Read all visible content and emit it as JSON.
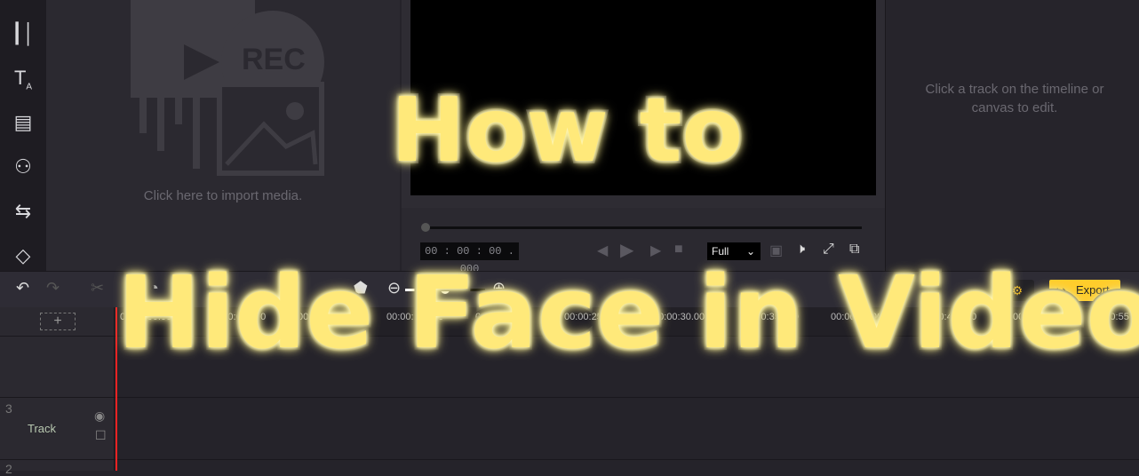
{
  "sidebar": {
    "icons": [
      "audio-wave-icon",
      "text-icon",
      "overlay-icon",
      "filter-icon",
      "transition-icon",
      "element-icon"
    ]
  },
  "media": {
    "import_text": "Click here to import media.",
    "rec_label": "REC"
  },
  "preview": {
    "timecode": "00 : 00 : 00 . 000",
    "zoom": "Full"
  },
  "properties": {
    "hint": "Click a track on the timeline or canvas to edit."
  },
  "toolbar": {
    "export_label": "Export"
  },
  "ruler": {
    "ticks": [
      "00:00:00.000",
      "00:00:05.000",
      "00:00:10.000",
      "00:00:15.000",
      "00:00:20.000",
      "00:00:25.000",
      "00:00:30.000",
      "00:00:35.000",
      "00:00:40.000",
      "00:00:45.000",
      "00:00:50.000",
      "00:00:55"
    ]
  },
  "tracks": [
    {
      "number": "3",
      "label": "Track"
    },
    {
      "number": "2"
    }
  ],
  "overlay": {
    "line1": "How to",
    "line2": "Hide Face in Video"
  },
  "colors": {
    "accent": "#ffcd2b",
    "overlay_text": "#ffe97a",
    "playhead": "#ee2222"
  }
}
